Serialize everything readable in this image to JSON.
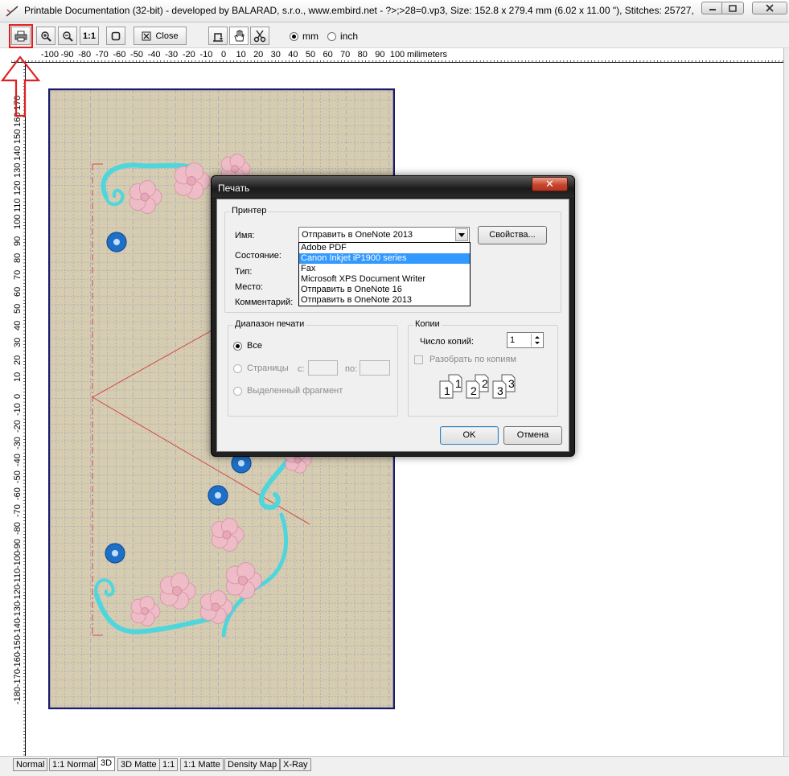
{
  "window": {
    "title": "Printable Documentation (32-bit) - developed by BALARAD, s.r.o., www.embird.net - ?>;>28=0.vp3, Size: 152.8 x 279.4 mm (6.02 x 11.00 \"), Stitches: 25727,"
  },
  "toolbar": {
    "close_label": "Close",
    "zoom_1to1_label": "1:1",
    "unit_mm": "mm",
    "unit_inch": "inch",
    "selected_unit": "mm"
  },
  "ruler": {
    "horizontal_labels": [
      "-100",
      "-90",
      "-80",
      "-70",
      "-60",
      "-50",
      "-40",
      "-30",
      "-20",
      "-10",
      "0",
      "10",
      "20",
      "30",
      "40",
      "50",
      "60",
      "70",
      "80",
      "90",
      "100"
    ],
    "horizontal_unit": "milimeters",
    "vertical_labels": [
      "170",
      "160",
      "150",
      "140",
      "130",
      "120",
      "110",
      "100",
      "90",
      "80",
      "70",
      "60",
      "50",
      "40",
      "30",
      "20",
      "10",
      "0",
      "-10",
      "-20",
      "-30",
      "-40",
      "-50",
      "-60",
      "-70",
      "-80",
      "-90",
      "-100",
      "-110",
      "-120",
      "-130",
      "-140",
      "-150",
      "-160",
      "-170",
      "-180"
    ]
  },
  "tabs": [
    {
      "label": "Normal",
      "active": false
    },
    {
      "label": "1:1 Normal",
      "active": false
    },
    {
      "label": "3D",
      "active": true
    },
    {
      "label": "3D Matte",
      "active": false
    },
    {
      "label": "1:1",
      "active": false
    },
    {
      "label": "1:1 Matte",
      "active": false
    },
    {
      "label": "Density Map",
      "active": false
    },
    {
      "label": "X-Ray",
      "active": false
    }
  ],
  "dialog": {
    "title": "Печать",
    "close_glyph": "✕",
    "printer_group": "Принтер",
    "name_label": "Имя:",
    "name_value": "Отправить в OneNote 2013",
    "status_label": "Состояние:",
    "type_label": "Тип:",
    "where_label": "Место:",
    "comment_label": "Комментарий:",
    "properties_button": "Свойства...",
    "printer_options": [
      "Adobe PDF",
      "Canon Inkjet iP1900 series",
      "Fax",
      "Microsoft XPS Document Writer",
      "Отправить в OneNote 16",
      "Отправить в OneNote 2013"
    ],
    "highlighted_option": "Canon Inkjet iP1900 series",
    "range_group": "Диапазон печати",
    "range_all": "Все",
    "range_pages": "Страницы",
    "range_from": "с:",
    "range_to": "по:",
    "range_selection": "Выделенный фрагмент",
    "copies_group": "Копии",
    "copies_label": "Число копий:",
    "copies_value": "1",
    "collate_label": "Разобрать по копиям",
    "collate_digits": [
      "1",
      "1",
      "2",
      "2",
      "3",
      "3"
    ],
    "ok_button": "OK",
    "cancel_button": "Отмена"
  },
  "colors": {
    "canvas_background": "#d6ccb0",
    "canvas_border": "#1a1a6e",
    "grid_line": "#a7a6bf",
    "annotation_red": "#e02020",
    "motif_cyan": "#4fd6dc",
    "motif_pink": "#f0bcc8",
    "motif_blue": "#1f6fc6",
    "selection_blue": "#3399ff"
  }
}
